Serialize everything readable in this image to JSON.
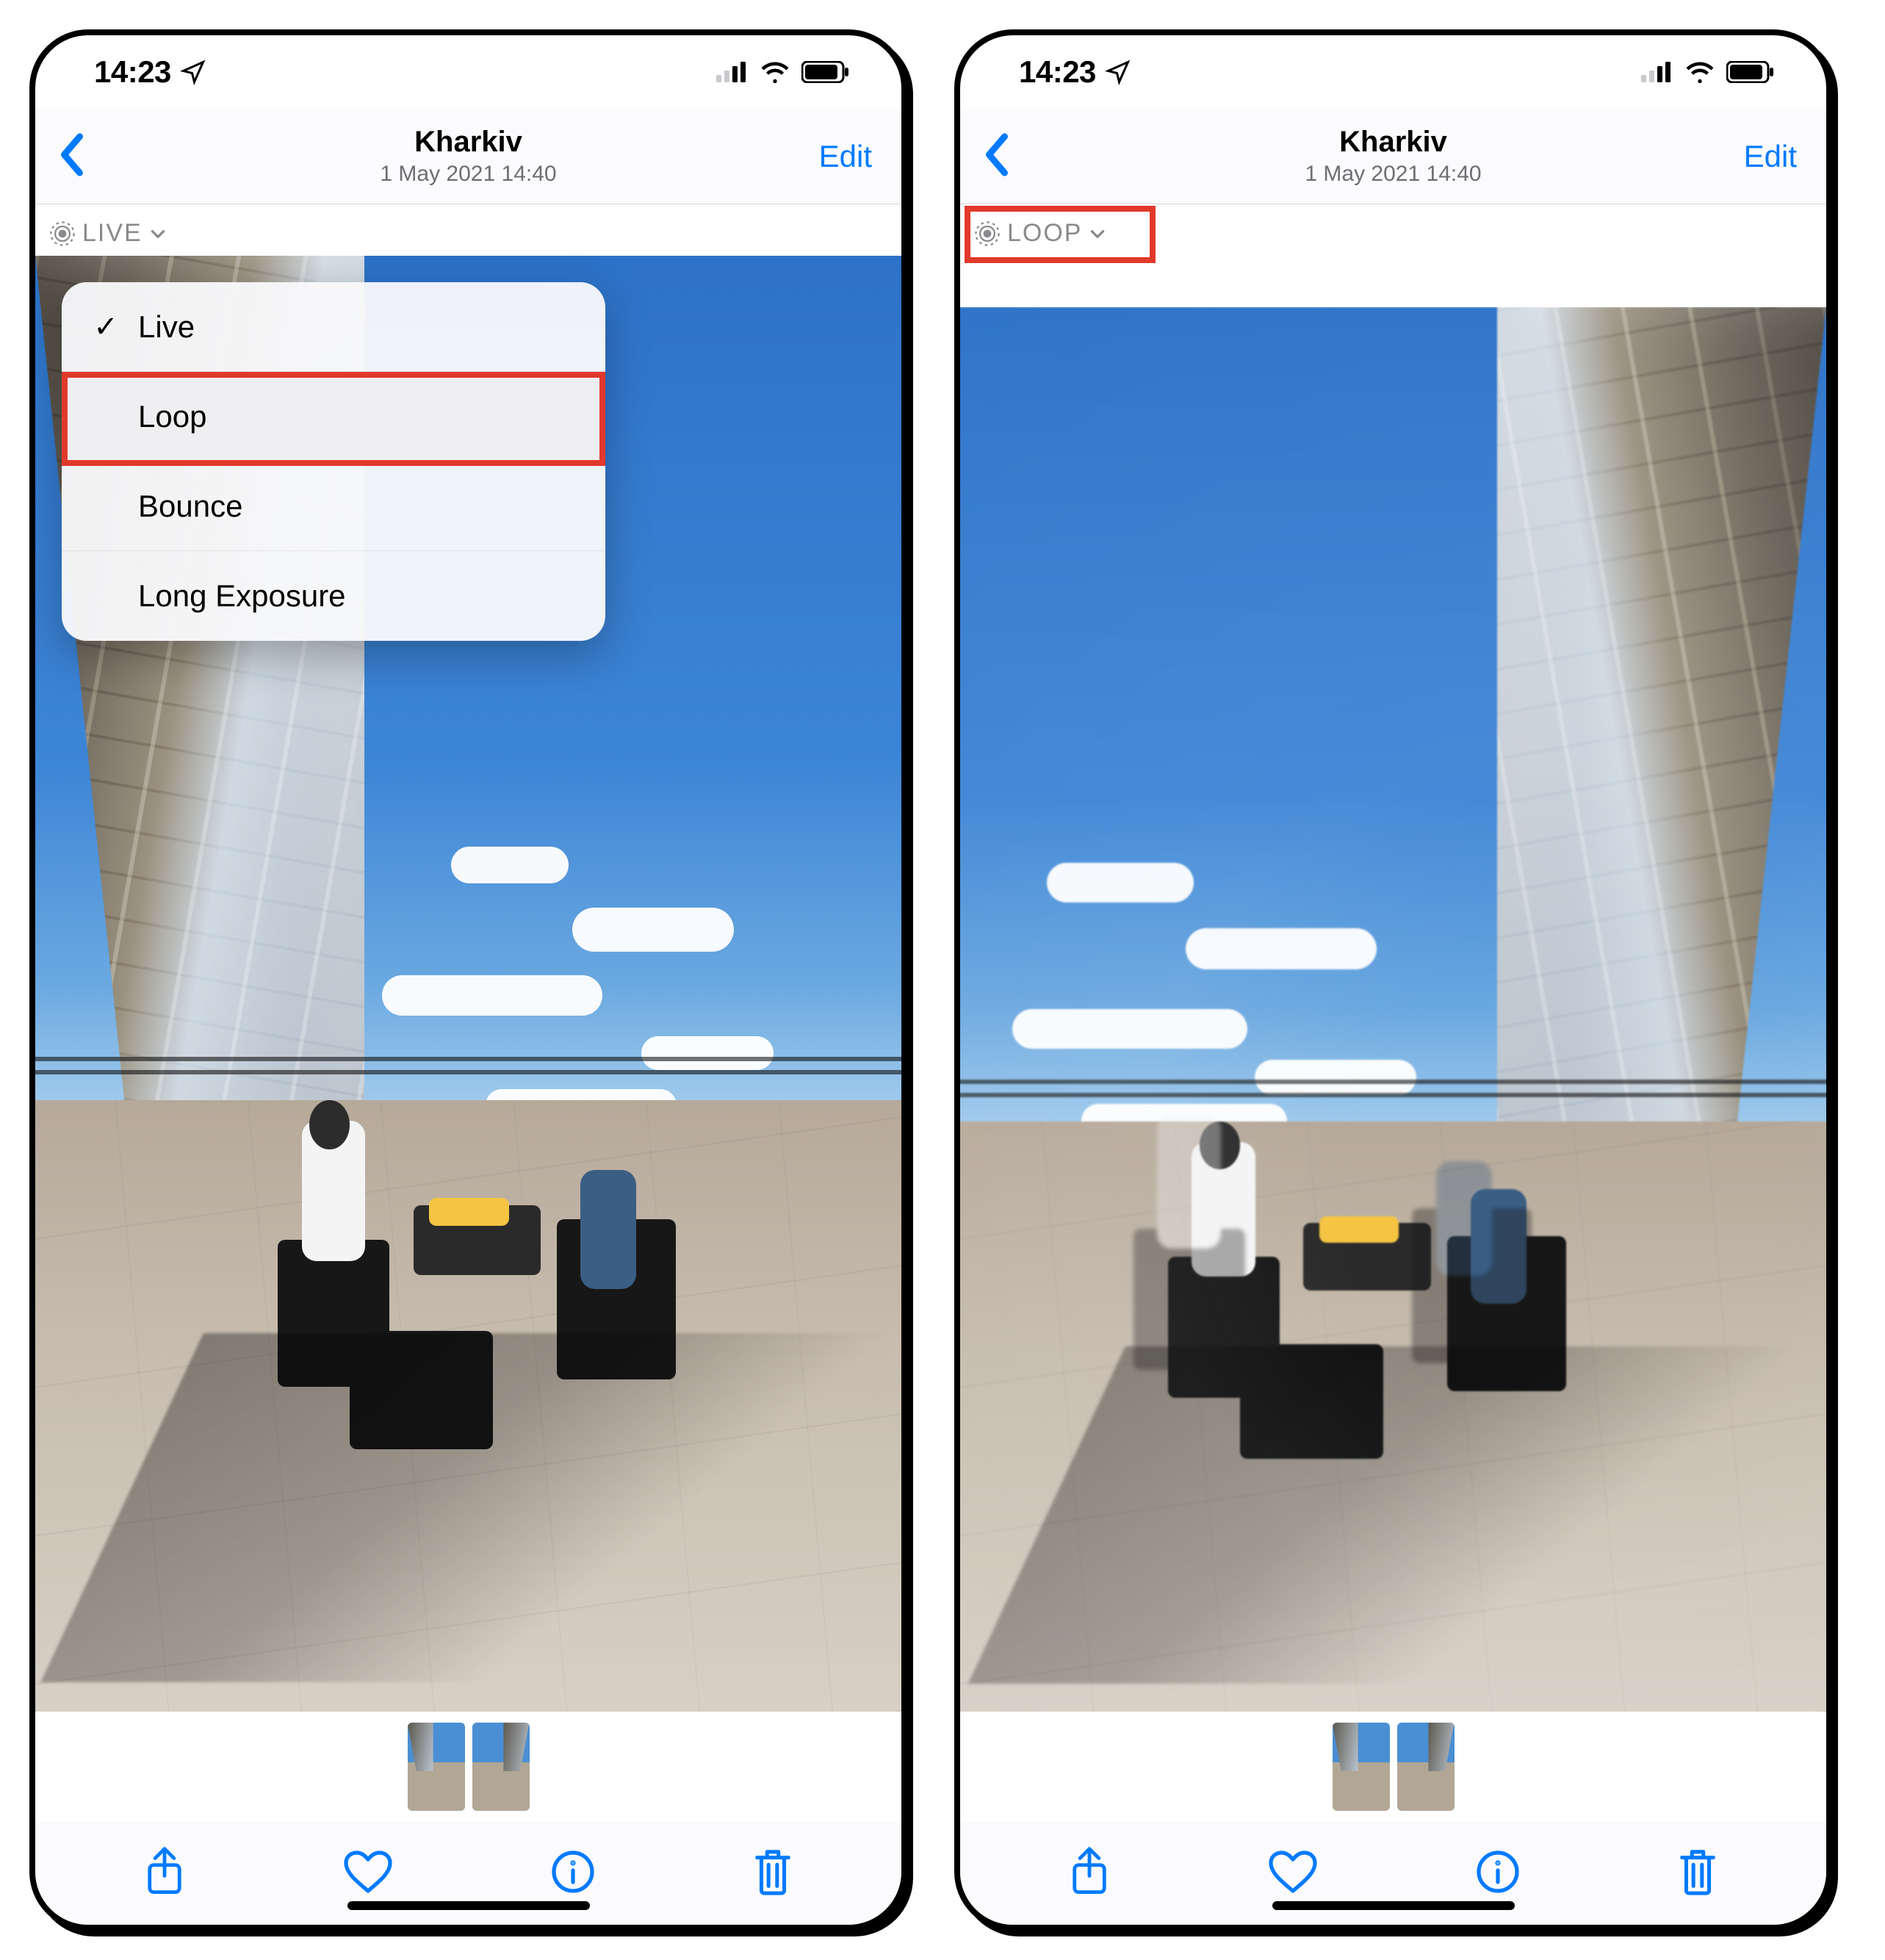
{
  "status": {
    "time": "14:23"
  },
  "nav": {
    "title": "Kharkiv",
    "subtitle": "1 May 2021  14:40",
    "edit": "Edit"
  },
  "badge": {
    "left_label": "LIVE",
    "right_label": "LOOP"
  },
  "menu": {
    "items": [
      {
        "label": "Live",
        "checked": true
      },
      {
        "label": "Loop",
        "checked": false
      },
      {
        "label": "Bounce",
        "checked": false
      },
      {
        "label": "Long Exposure",
        "checked": false
      }
    ],
    "highlight_index": 1
  },
  "colors": {
    "accent": "#007aff",
    "callout": "#e1392c"
  }
}
